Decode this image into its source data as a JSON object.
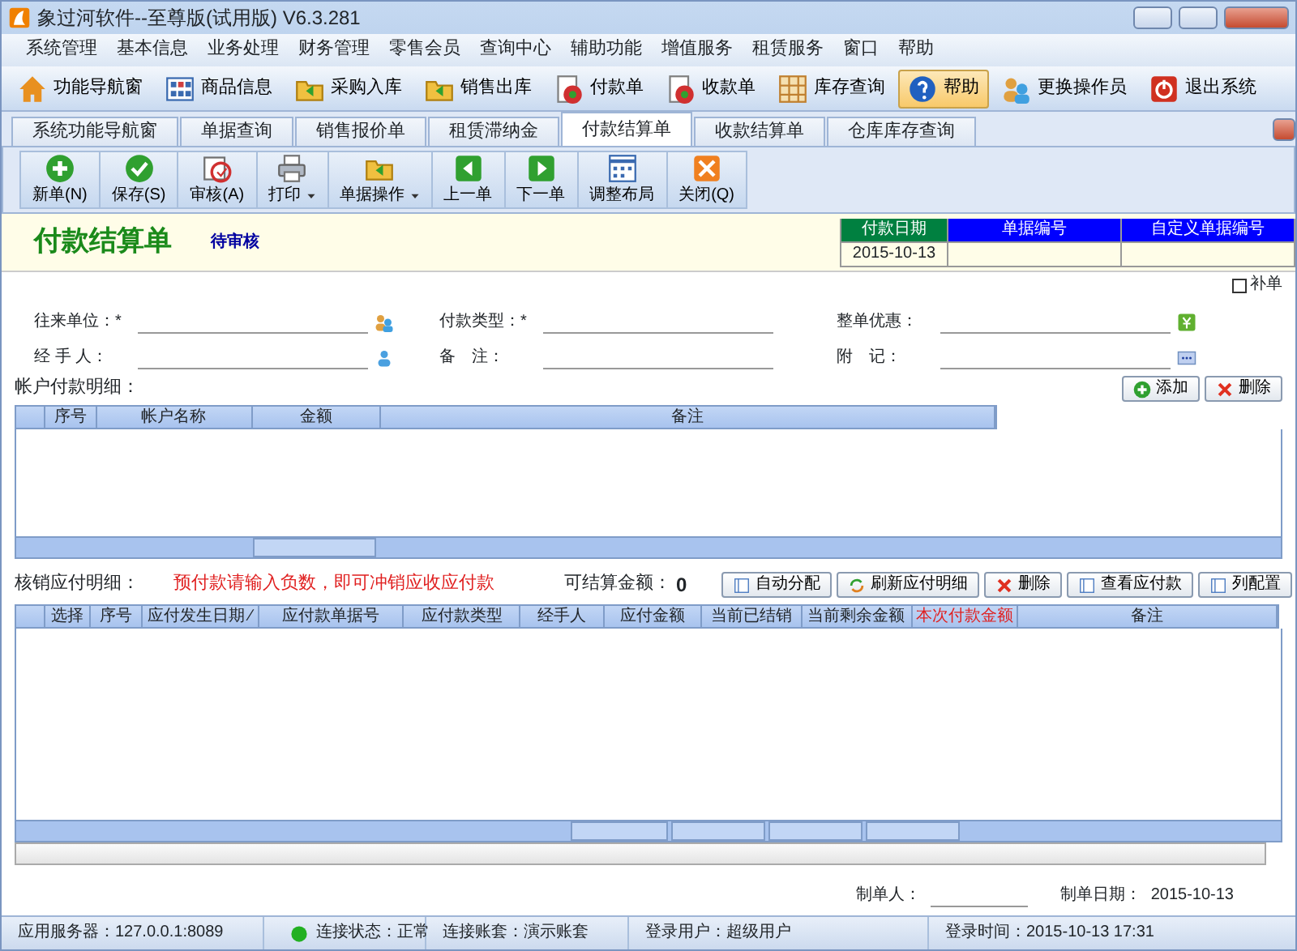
{
  "window": {
    "title": "象过河软件--至尊版(试用版) V6.3.281"
  },
  "menu": [
    "系统管理",
    "基本信息",
    "业务处理",
    "财务管理",
    "零售会员",
    "查询中心",
    "辅助功能",
    "增值服务",
    "租赁服务",
    "窗口",
    "帮助"
  ],
  "toolbar": [
    {
      "label": "功能导航窗",
      "selected": false
    },
    {
      "label": "商品信息",
      "selected": false
    },
    {
      "label": "采购入库",
      "selected": false
    },
    {
      "label": "销售出库",
      "selected": false
    },
    {
      "label": "付款单",
      "selected": false
    },
    {
      "label": "收款单",
      "selected": false
    },
    {
      "label": "库存查询",
      "selected": false
    },
    {
      "label": "帮助",
      "selected": true
    },
    {
      "label": "更换操作员",
      "selected": false
    },
    {
      "label": "退出系统",
      "selected": false
    }
  ],
  "tabs": [
    {
      "label": "系统功能导航窗",
      "selected": false
    },
    {
      "label": "单据查询",
      "selected": false
    },
    {
      "label": "销售报价单",
      "selected": false
    },
    {
      "label": "租赁滞纳金",
      "selected": false
    },
    {
      "label": "付款结算单",
      "selected": true
    },
    {
      "label": "收款结算单",
      "selected": false
    },
    {
      "label": "仓库库存查询",
      "selected": false
    }
  ],
  "doc_toolbar": [
    {
      "label": "新单(N)",
      "dropdown": false
    },
    {
      "label": "保存(S)",
      "dropdown": false
    },
    {
      "label": "审核(A)",
      "dropdown": false
    },
    {
      "label": "打印",
      "dropdown": true
    },
    {
      "label": "单据操作",
      "dropdown": true
    },
    {
      "label": "上一单",
      "dropdown": false
    },
    {
      "label": "下一单",
      "dropdown": false
    },
    {
      "label": "调整布局",
      "dropdown": false
    },
    {
      "label": "关闭(Q)",
      "dropdown": false
    }
  ],
  "header": {
    "title": "付款结算单",
    "status": "待审核",
    "info": [
      {
        "label": "付款日期",
        "color": "#008040",
        "value": "2015-10-13"
      },
      {
        "label": "单据编号",
        "color": "#0000ff"
      },
      {
        "label": "自定义单据编号",
        "color": "#0000ff"
      }
    ]
  },
  "supplement": {
    "label": "补单",
    "checked": false
  },
  "fields": [
    {
      "label": "往来单位：*",
      "kind": "people"
    },
    {
      "label": "付款类型：*"
    },
    {
      "label": "整单优惠：",
      "kind": "calc"
    },
    {
      "label": "经 手 人：",
      "kind": "person"
    },
    {
      "label": "备　注："
    },
    {
      "label": "附　记：",
      "kind": "more"
    }
  ],
  "account_details": {
    "label": "帐户付款明细：",
    "buttons": [
      "添加",
      "删除"
    ],
    "columns": [
      "序号",
      "帐户名称",
      "金额",
      "备注"
    ]
  },
  "writeoff": {
    "label": "核销应付明细：",
    "hint": "预付款请输入负数，即可冲销应收应付款",
    "amount_label": "可结算金额：",
    "amount": "0",
    "buttons": [
      "自动分配",
      "刷新应付明细",
      "删除",
      "查看应付款",
      "列配置"
    ],
    "columns": [
      {
        "label": "选择",
        "highlight": false
      },
      {
        "label": "序号",
        "highlight": false
      },
      {
        "label": "应付发生日期 ⁄",
        "highlight": false
      },
      {
        "label": "应付款单据号",
        "highlight": false
      },
      {
        "label": "应付款类型",
        "highlight": false
      },
      {
        "label": "经手人",
        "highlight": false
      },
      {
        "label": "应付金额",
        "highlight": false
      },
      {
        "label": "当前已结销",
        "highlight": false
      },
      {
        "label": "当前剩余金额",
        "highlight": false
      },
      {
        "label": "本次付款金额",
        "highlight": true
      },
      {
        "label": "备注",
        "highlight": false
      }
    ]
  },
  "footer": {
    "maker_label": "制单人：",
    "date_label": "制单日期：",
    "date": "2015-10-13"
  },
  "status_bar": [
    {
      "text": "应用服务器：127.0.0.1:8089"
    },
    {
      "text": "连接状态：正常",
      "color": "#22b022"
    },
    {
      "text": "连接账套：演示账套"
    },
    {
      "text": "登录用户：超级用户"
    },
    {
      "text": "登录时间：2015-10-13 17:31"
    }
  ]
}
